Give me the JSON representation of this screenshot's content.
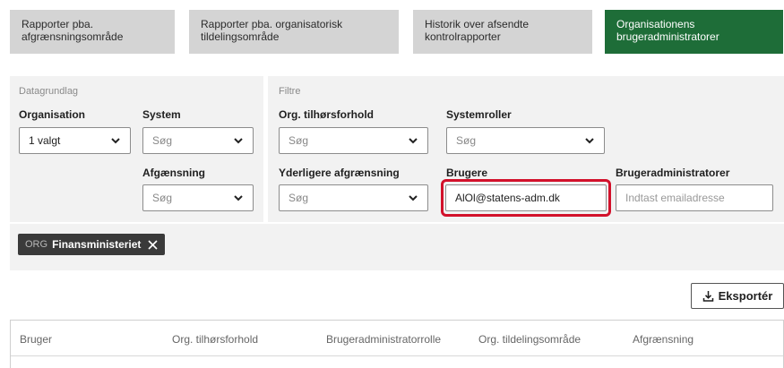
{
  "tabs": [
    {
      "label": "Rapporter pba. afgrænsningsområde",
      "line1": "Rapporter pba.",
      "line2": "afgrænsningsområde",
      "active": false
    },
    {
      "label": "Rapporter pba. organisatorisk tildelingsområde",
      "line1": "Rapporter pba. organisatorisk",
      "line2": "tildelingsområde",
      "active": false
    },
    {
      "label": "Historik over afsendte kontrolrapporter",
      "line1": "Historik over afsendte",
      "line2": "kontrolrapporter",
      "active": false
    },
    {
      "label": "Organisationens brugeradministratorer",
      "line1": "Organisationens",
      "line2": "brugeradministratorer",
      "active": true
    }
  ],
  "datagrundlag": {
    "title": "Datagrundlag",
    "organisation": {
      "label": "Organisation",
      "value": "1 valgt"
    },
    "system": {
      "label": "System",
      "placeholder": "Søg"
    },
    "afgraensning": {
      "label": "Afgænsning",
      "placeholder": "Søg"
    }
  },
  "filtre": {
    "title": "Filtre",
    "org_tilhoersforhold": {
      "label": "Org. tilhørsforhold",
      "placeholder": "Søg"
    },
    "systemroller": {
      "label": "Systemroller",
      "placeholder": "Søg"
    },
    "yderligere": {
      "label": "Yderligere afgrænsning",
      "placeholder": "Søg"
    },
    "brugere": {
      "label": "Brugere",
      "value": "AlOl@statens-adm.dk"
    },
    "brugeradministratorer": {
      "label": "Brugeradministratorer",
      "placeholder": "Indtast emailadresse"
    }
  },
  "chip": {
    "tag": "ORG",
    "name": "Finansministeriet",
    "remove_icon": "close-icon"
  },
  "export": {
    "label": "Eksportér",
    "icon": "download-icon"
  },
  "table": {
    "columns": [
      "Bruger",
      "Org. tilhørsforhold",
      "Brugeradministratorrolle",
      "Org. tildelingsområde",
      "Afgrænsning"
    ]
  },
  "colors": {
    "accent": "#1e6d38",
    "highlight": "#d2112b"
  }
}
